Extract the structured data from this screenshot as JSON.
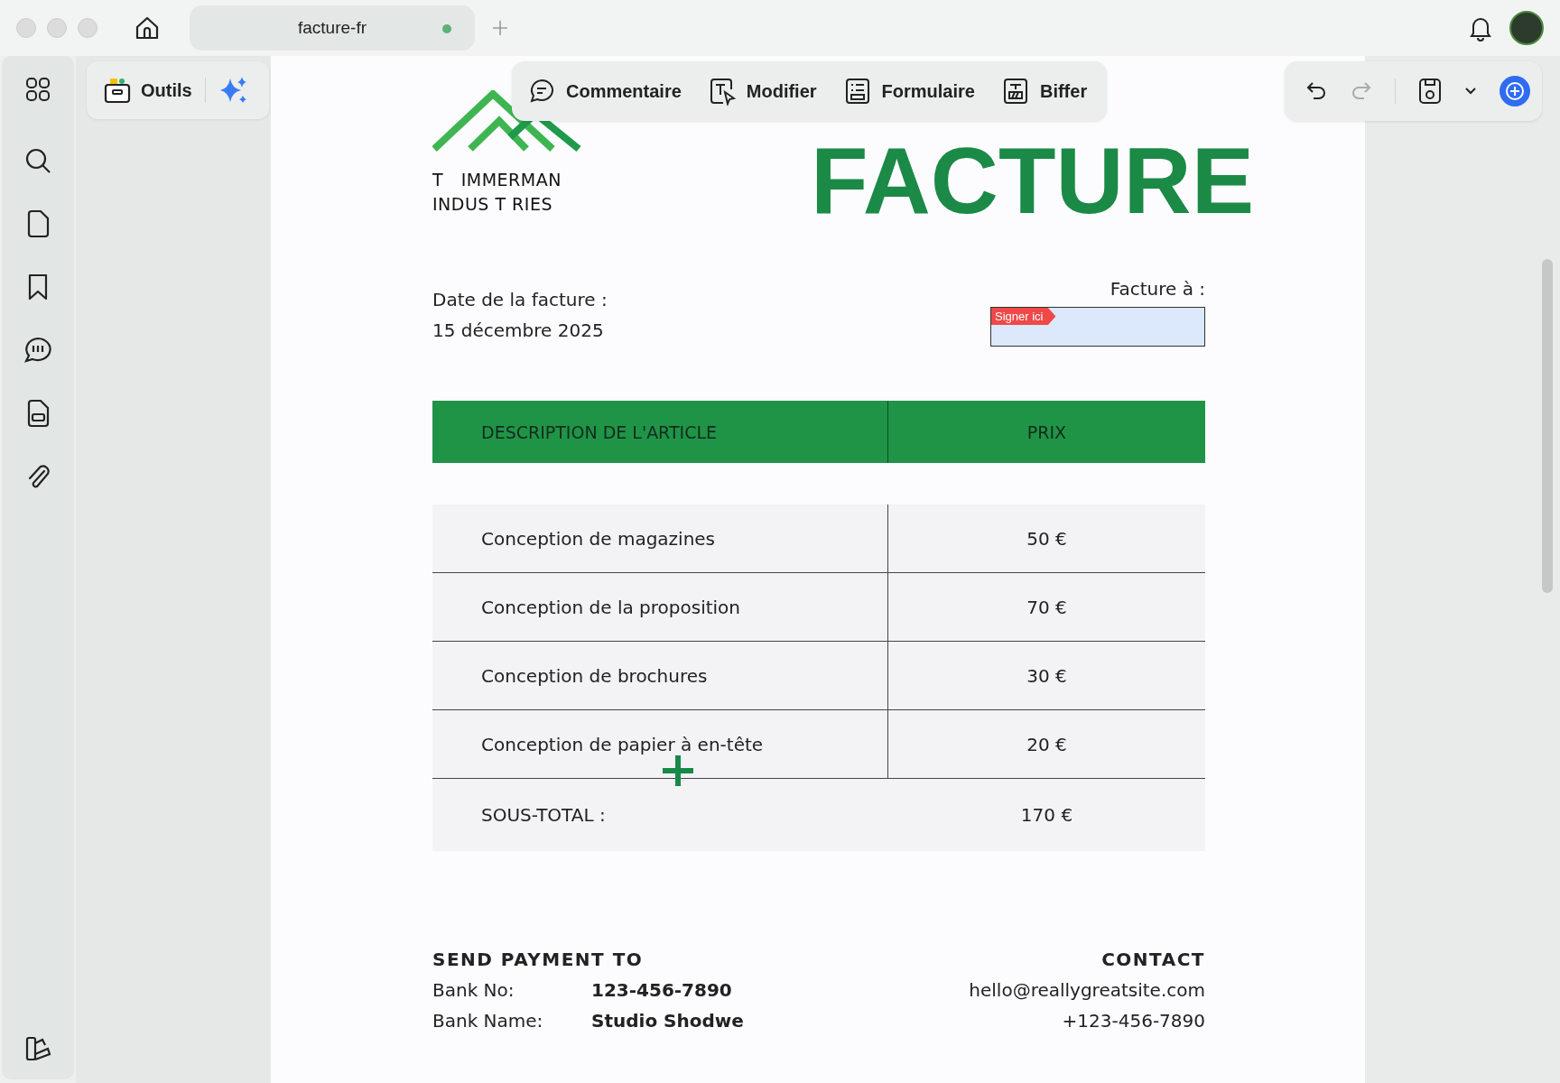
{
  "window": {
    "tab": {
      "title": "facture-fr",
      "unsaved": true
    }
  },
  "toolbar": {
    "tools_button": "Outils",
    "tools": [
      "Commentaire",
      "Modifier",
      "Formulaire",
      "Biffer"
    ]
  },
  "document": {
    "company": [
      "T   IMMERMAN",
      "INDUS T RIES"
    ],
    "title": "FACTURE",
    "date_label": "Date de la facture :",
    "date": "15 décembre 2025",
    "bill_to": "Facture à :",
    "sign_tag": "Signer ici",
    "table": {
      "columns": [
        "DESCRIPTION DE L'ARTICLE",
        "PRIX"
      ],
      "rows": [
        [
          "Conception de magazines",
          "50 €"
        ],
        [
          "Conception de la proposition",
          "70 €"
        ],
        [
          "Conception de brochures",
          "30 €"
        ],
        [
          "Conception de papier à en-tête",
          "20 €"
        ]
      ],
      "subtotal": [
        "SOUS-TOTAL :",
        "170 €"
      ]
    },
    "payment": {
      "heading": "SEND PAYMENT TO",
      "rows": [
        [
          "Bank No:",
          "123-456-7890"
        ],
        [
          "Bank Name:",
          "Studio Shodwe"
        ]
      ]
    },
    "contact": {
      "heading": "CONTACT",
      "lines": [
        "hello@reallygreatsite.com",
        "+123-456-7890"
      ]
    }
  }
}
